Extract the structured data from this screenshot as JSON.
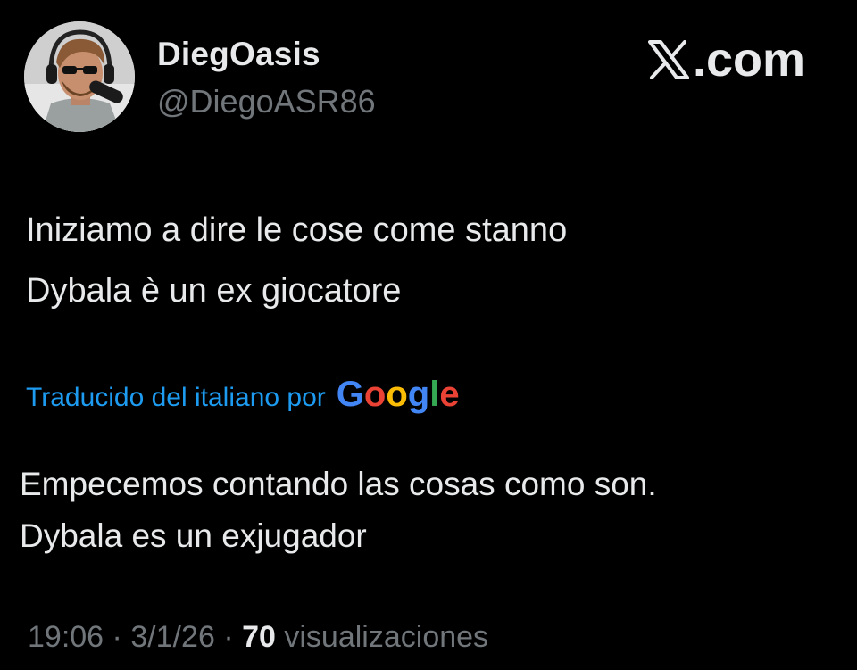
{
  "author": {
    "display_name": "DiegOasis",
    "handle": "@DiegoASR86"
  },
  "brand": {
    "x_label": "𝕏",
    "domain": ".com"
  },
  "tweet": {
    "lines": [
      "Iniziamo a dire le cose come stanno",
      "Dybala è un ex giocatore"
    ]
  },
  "translation": {
    "label": "Traducido del italiano por",
    "provider_letters": [
      "G",
      "o",
      "o",
      "g",
      "l",
      "e"
    ],
    "lines": [
      "Empecemos contando las cosas como son.",
      "Dybala es un exjugador"
    ]
  },
  "meta": {
    "time": "19:06",
    "separator": "·",
    "date": "3/1/26",
    "views_count": "70",
    "views_label": "visualizaciones"
  },
  "colors": {
    "background": "#000000",
    "primary_text": "#e7e9ea",
    "secondary_text": "#71767b",
    "link": "#1d9bf0",
    "google_blue": "#4285f4",
    "google_red": "#ea4335",
    "google_yellow": "#fbbc05",
    "google_green": "#34a853"
  }
}
